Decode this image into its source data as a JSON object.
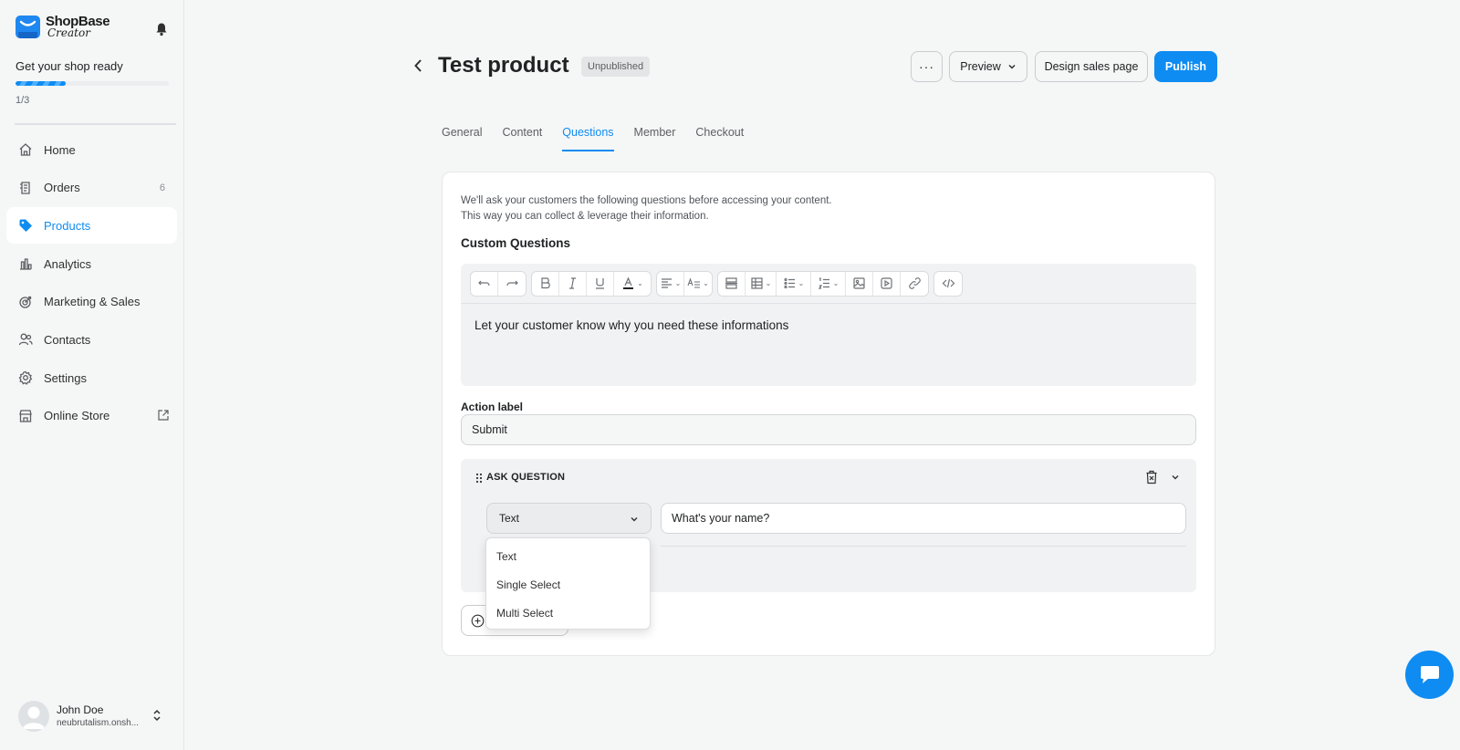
{
  "brand": {
    "name": "ShopBase",
    "sub": "Creator"
  },
  "setup": {
    "title": "Get your shop ready",
    "progress": "1/3",
    "progress_fraction": 0.333
  },
  "sidebar": {
    "items": [
      {
        "label": "Home",
        "icon": "home-icon"
      },
      {
        "label": "Orders",
        "icon": "orders-icon",
        "count": "6"
      },
      {
        "label": "Products",
        "icon": "tag-icon",
        "active": true
      },
      {
        "label": "Analytics",
        "icon": "bar-chart-icon"
      },
      {
        "label": "Marketing & Sales",
        "icon": "target-icon"
      },
      {
        "label": "Contacts",
        "icon": "contacts-icon"
      },
      {
        "label": "Settings",
        "icon": "gear-icon"
      },
      {
        "label": "Online Store",
        "icon": "store-icon"
      }
    ]
  },
  "user": {
    "name": "John Doe",
    "shop": "neubrutalism.onsh..."
  },
  "header": {
    "title": "Test product",
    "status": "Unpublished",
    "more_label": "···",
    "preview_label": "Preview",
    "design_label": "Design sales page",
    "publish_label": "Publish"
  },
  "tabs": [
    {
      "label": "General"
    },
    {
      "label": "Content"
    },
    {
      "label": "Questions",
      "active": true
    },
    {
      "label": "Member"
    },
    {
      "label": "Checkout"
    }
  ],
  "questions": {
    "intro_line1": "We'll ask your customers the following questions before accessing your content.",
    "intro_line2": "This way you can collect & leverage their information.",
    "section_title": "Custom Questions",
    "editor_text": "Let your customer know why you need these informations",
    "action_label_title": "Action label",
    "action_label_value": "Submit",
    "ask_title": "ASK QUESTION",
    "type_selected": "Text",
    "question_value": "What's your name?",
    "question_placeholder": "What's your name?",
    "type_options": [
      "Text",
      "Single Select",
      "Multi Select"
    ]
  },
  "colors": {
    "accent": "#0e8cf2",
    "background": "#f5f6f6",
    "text": "#202223"
  }
}
